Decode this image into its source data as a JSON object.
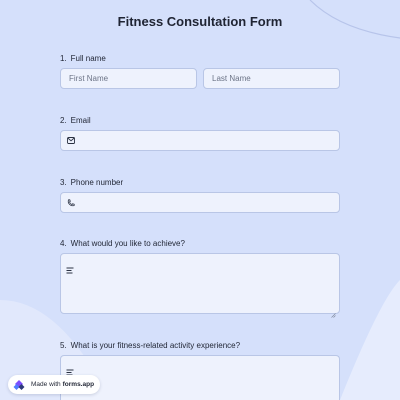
{
  "form": {
    "title": "Fitness Consultation Form"
  },
  "questions": {
    "full_name": {
      "number": "1.",
      "label": "Full name",
      "first_placeholder": "First Name",
      "last_placeholder": "Last Name"
    },
    "email": {
      "number": "2.",
      "label": "Email"
    },
    "phone": {
      "number": "3.",
      "label": "Phone number"
    },
    "achieve": {
      "number": "4.",
      "label": "What would you like to achieve?"
    },
    "experience": {
      "number": "5.",
      "label": "What is your fitness-related activity experience?"
    }
  },
  "badge": {
    "prefix": "Made with",
    "brand": "forms.app"
  },
  "icons": {
    "email": "mail-icon",
    "phone": "phone-icon",
    "text": "text-lines-icon",
    "badge": "forms-app-logo-icon"
  },
  "colors": {
    "background": "#d5e0fb",
    "field_bg": "#eef2fd",
    "field_border": "#b9c6e6",
    "brand_purple": "#7c4dff"
  }
}
